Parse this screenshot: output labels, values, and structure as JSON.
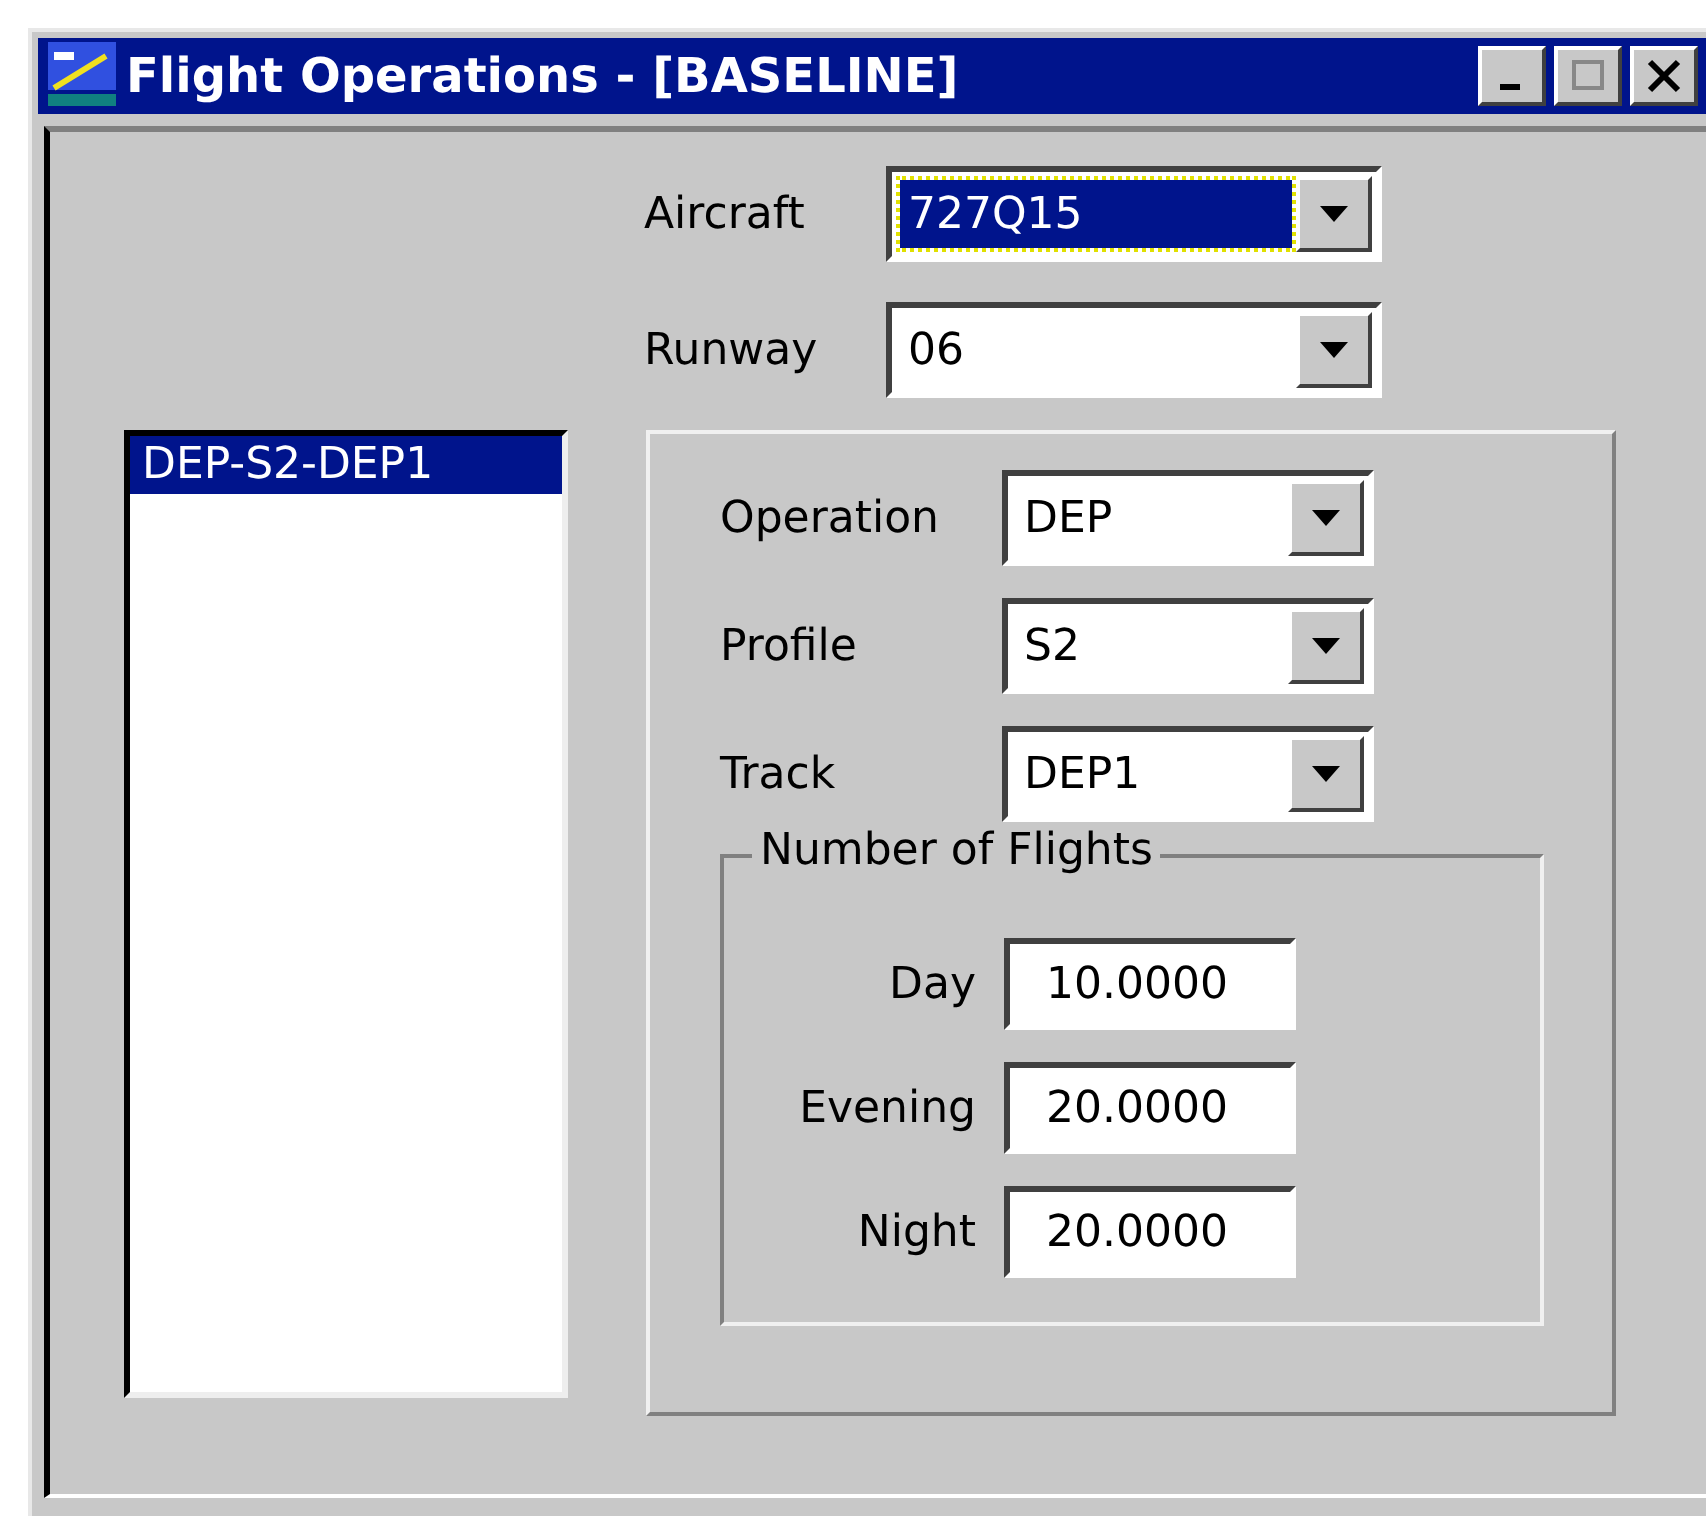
{
  "window": {
    "title": "Flight Operations - [BASELINE]"
  },
  "selectors": [
    {
      "label": "Aircraft",
      "value": "727Q15",
      "focused": true
    },
    {
      "label": "Runway",
      "value": "06",
      "focused": false
    }
  ],
  "operations_list": [
    {
      "label": "DEP-S2-DEP1",
      "selected": true
    }
  ],
  "details": [
    {
      "label": "Operation",
      "value": "DEP"
    },
    {
      "label": "Profile",
      "value": "S2"
    },
    {
      "label": "Track",
      "value": "DEP1"
    }
  ],
  "number_of_flights": {
    "title": "Number of Flights",
    "fields": [
      {
        "label": "Day",
        "value": "10.0000"
      },
      {
        "label": "Evening",
        "value": "20.0000"
      },
      {
        "label": "Night",
        "value": "20.0000"
      }
    ]
  }
}
